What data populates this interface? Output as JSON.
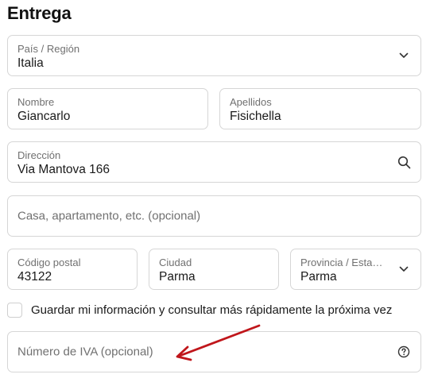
{
  "section_title": "Entrega",
  "country": {
    "label": "País / Región",
    "value": "Italia",
    "icon": "chevron-down-icon"
  },
  "first_name": {
    "label": "Nombre",
    "value": "Giancarlo"
  },
  "last_name": {
    "label": "Apellidos",
    "value": "Fisichella"
  },
  "address": {
    "label": "Dirección",
    "value": "Via Mantova 166",
    "icon": "search-icon"
  },
  "address2": {
    "placeholder": "Casa, apartamento, etc. (opcional)"
  },
  "postal_code": {
    "label": "Código postal",
    "value": "43122"
  },
  "city": {
    "label": "Ciudad",
    "value": "Parma"
  },
  "province": {
    "label": "Provincia / Esta…",
    "value": "Parma",
    "icon": "chevron-down-icon"
  },
  "save_info": {
    "label": "Guardar mi información y consultar más rápidamente la próxima vez",
    "checked": false
  },
  "vat": {
    "placeholder": "Número de IVA (opcional)",
    "icon": "help-circle-icon"
  },
  "colors": {
    "annotation_arrow": "#c0161b",
    "border": "#d6d6d6",
    "muted_text": "#707070"
  }
}
